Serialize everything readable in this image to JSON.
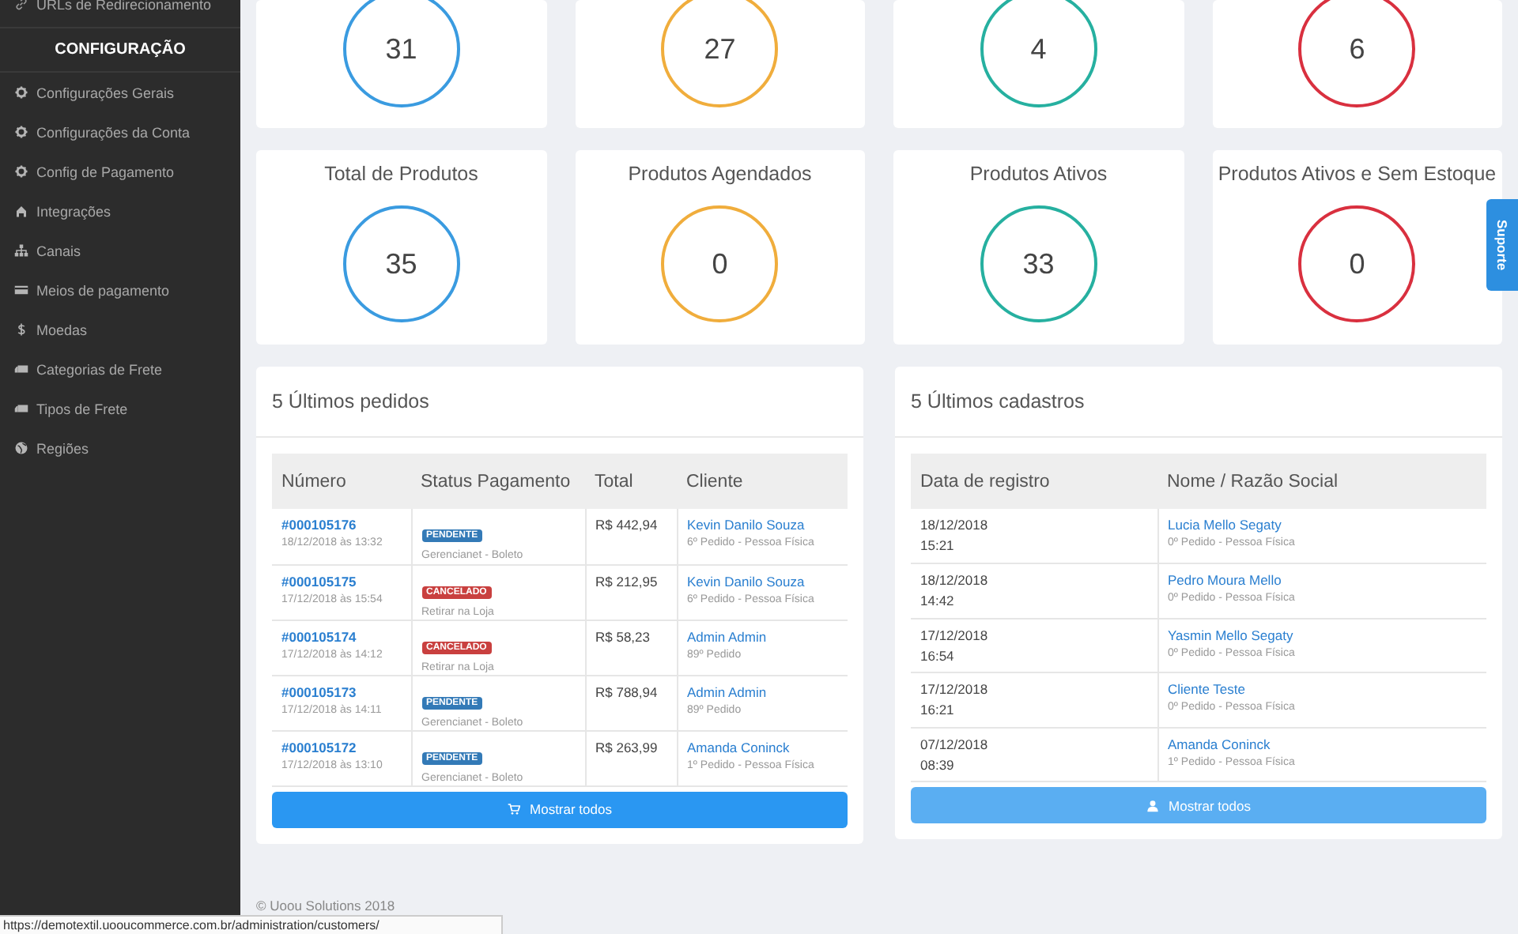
{
  "sidebar": {
    "top_item": {
      "label": "URLs de Redirecionamento"
    },
    "section": "CONFIGURAÇÃO",
    "items": [
      {
        "label": "Configurações Gerais"
      },
      {
        "label": "Configurações da Conta"
      },
      {
        "label": "Config de Pagamento"
      },
      {
        "label": "Integrações"
      },
      {
        "label": "Canais"
      },
      {
        "label": "Meios de pagamento"
      },
      {
        "label": "Moedas"
      },
      {
        "label": "Categorias de Frete"
      },
      {
        "label": "Tipos de Frete"
      },
      {
        "label": "Regiões"
      }
    ]
  },
  "stats_top": [
    {
      "value": "31",
      "color": "#3a9be0"
    },
    {
      "value": "27",
      "color": "#f0ad3c"
    },
    {
      "value": "4",
      "color": "#26b0a0"
    },
    {
      "value": "6",
      "color": "#d9303f"
    }
  ],
  "stats": [
    {
      "title": "Total de Produtos",
      "value": "35",
      "color": "#3a9be0"
    },
    {
      "title": "Produtos Agendados",
      "value": "0",
      "color": "#f0ad3c"
    },
    {
      "title": "Produtos Ativos",
      "value": "33",
      "color": "#26b0a0"
    },
    {
      "title": "Produtos Ativos e Sem Estoque",
      "value": "0",
      "color": "#d9303f"
    }
  ],
  "orders": {
    "title": "5 Últimos pedidos",
    "columns": [
      "Número",
      "Status Pagamento",
      "Total",
      "Cliente"
    ],
    "rows": [
      {
        "number": "#000105176",
        "date": "18/12/2018 às 13:32",
        "status": {
          "label": "PENDENTE",
          "color": "#337ab7"
        },
        "method": "Gerencianet - Boleto",
        "total": "R$ 442,94",
        "client": "Kevin Danilo Souza",
        "client_note": "6º Pedido - Pessoa Física"
      },
      {
        "number": "#000105175",
        "date": "17/12/2018 às 15:54",
        "status": {
          "label": "CANCELADO",
          "color": "#c9403f"
        },
        "method": "Retirar na Loja",
        "total": "R$ 212,95",
        "client": "Kevin Danilo Souza",
        "client_note": "6º Pedido - Pessoa Física"
      },
      {
        "number": "#000105174",
        "date": "17/12/2018 às 14:12",
        "status": {
          "label": "CANCELADO",
          "color": "#c9403f"
        },
        "method": "Retirar na Loja",
        "total": "R$ 58,23",
        "client": "Admin Admin",
        "client_note": "89º Pedido"
      },
      {
        "number": "#000105173",
        "date": "17/12/2018 às 14:11",
        "status": {
          "label": "PENDENTE",
          "color": "#337ab7"
        },
        "method": "Gerencianet - Boleto",
        "total": "R$ 788,94",
        "client": "Admin Admin",
        "client_note": "89º Pedido"
      },
      {
        "number": "#000105172",
        "date": "17/12/2018 às 13:10",
        "status": {
          "label": "PENDENTE",
          "color": "#337ab7"
        },
        "method": "Gerencianet - Boleto",
        "total": "R$ 263,99",
        "client": "Amanda Coninck",
        "client_note": "1º Pedido - Pessoa Física"
      }
    ],
    "button": "Mostrar todos"
  },
  "registrations": {
    "title": "5 Últimos cadastros",
    "columns": [
      "Data de registro",
      "Nome / Razão Social"
    ],
    "rows": [
      {
        "date": "18/12/2018",
        "time": "15:21",
        "name": "Lucia Mello Segaty",
        "note": "0º Pedido - Pessoa Física"
      },
      {
        "date": "18/12/2018",
        "time": "14:42",
        "name": "Pedro Moura Mello",
        "note": "0º Pedido - Pessoa Física"
      },
      {
        "date": "17/12/2018",
        "time": "16:54",
        "name": "Yasmin Mello Segaty",
        "note": "0º Pedido - Pessoa Física"
      },
      {
        "date": "17/12/2018",
        "time": "16:21",
        "name": "Cliente Teste",
        "note": "0º Pedido - Pessoa Física"
      },
      {
        "date": "07/12/2018",
        "time": "08:39",
        "name": "Amanda Coninck",
        "note": "1º Pedido - Pessoa Física"
      }
    ],
    "button": "Mostrar todos"
  },
  "footer": "© Uoou Solutions 2018",
  "support_tab": "Suporte",
  "status_url": "https://demotextil.uooucommerce.com.br/administration/customers/"
}
